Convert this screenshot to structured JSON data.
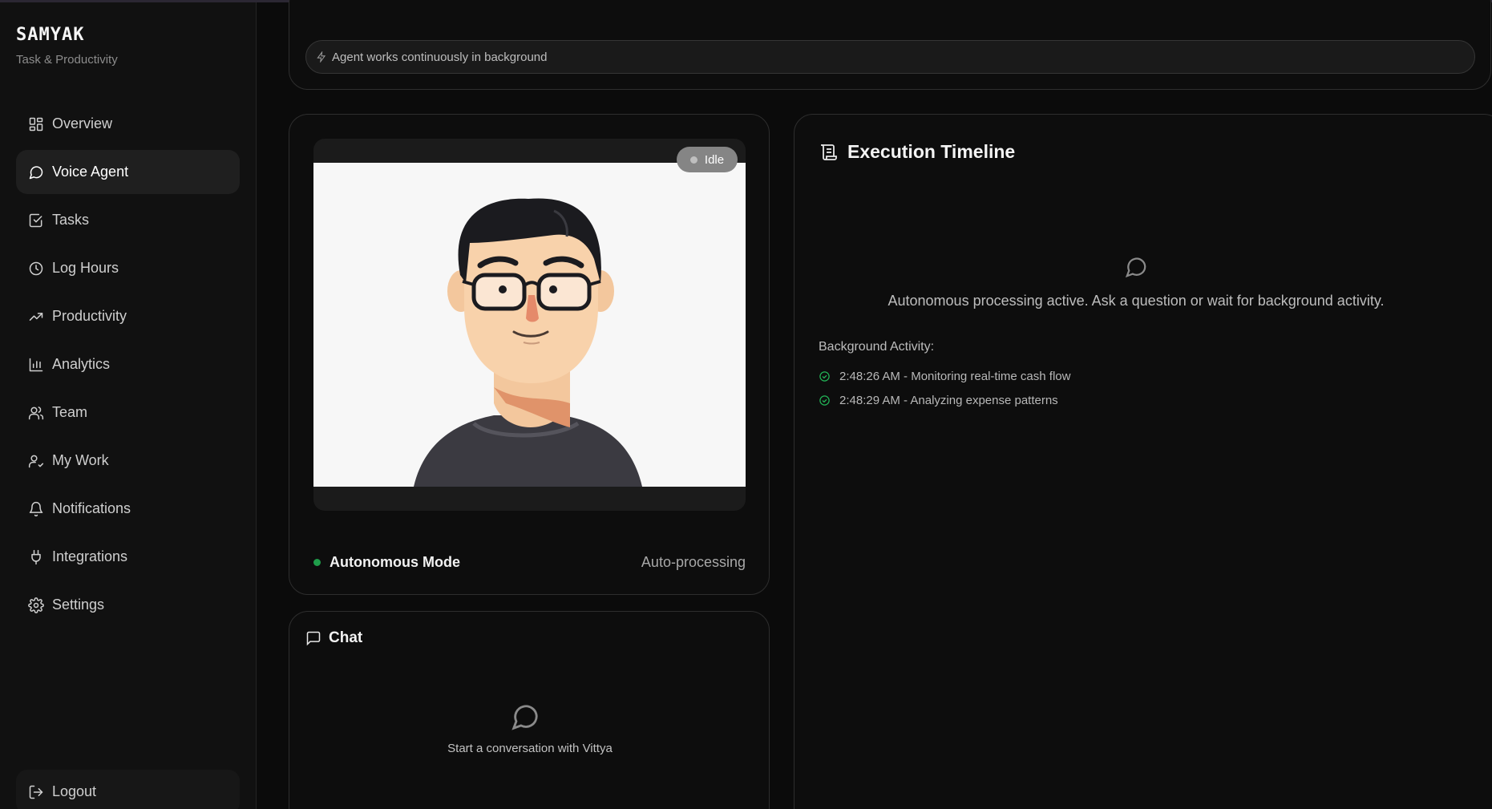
{
  "sidebar": {
    "brand_title": "SAMYAK",
    "brand_subtitle": "Task & Productivity",
    "items": [
      {
        "label": "Overview",
        "icon": "grid-icon"
      },
      {
        "label": "Voice Agent",
        "icon": "message-circle-icon",
        "active": true
      },
      {
        "label": "Tasks",
        "icon": "check-square-icon"
      },
      {
        "label": "Log Hours",
        "icon": "clock-icon"
      },
      {
        "label": "Productivity",
        "icon": "trending-up-icon"
      },
      {
        "label": "Analytics",
        "icon": "bar-chart-icon"
      },
      {
        "label": "Team",
        "icon": "users-icon"
      },
      {
        "label": "My Work",
        "icon": "user-check-icon"
      },
      {
        "label": "Notifications",
        "icon": "bell-icon"
      },
      {
        "label": "Integrations",
        "icon": "plug-icon"
      },
      {
        "label": "Settings",
        "icon": "gear-icon"
      }
    ],
    "logout_label": "Logout"
  },
  "status": {
    "text": "Agent works continuously in background",
    "icon": "lightning-icon"
  },
  "avatar_panel": {
    "badge": "Idle",
    "mode_label": "Autonomous Mode",
    "mode_status": "Auto-processing",
    "mode_color": "#1f9d4a"
  },
  "chat": {
    "title": "Chat",
    "empty_text": "Start a conversation with Vittya"
  },
  "timeline": {
    "title": "Execution Timeline",
    "empty_text": "Autonomous processing active. Ask a question or wait for background activity.",
    "background_label": "Background Activity:",
    "activities": [
      "2:48:26 AM - Monitoring real-time cash flow",
      "2:48:29 AM - Analyzing expense patterns"
    ],
    "check_color": "#22b356"
  }
}
